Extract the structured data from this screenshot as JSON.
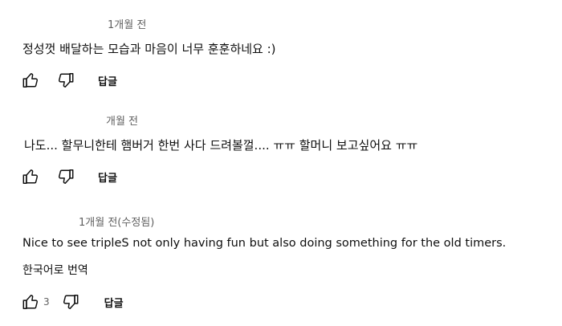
{
  "comments": [
    {
      "time": "1개월 전",
      "text": "정성껏 배달하는 모습과 마음이 너무 훈훈하네요 :)",
      "like_count": "",
      "reply_label": "답글"
    },
    {
      "time": "개월 전",
      "text": "나도... 할무니한테 햄버거 한번 사다 드려볼껄.... ㅠㅠ 할머니 보고싶어요 ㅠㅠ",
      "like_count": "",
      "reply_label": "답글"
    },
    {
      "time": "1개월 전(수정됨)",
      "text": "Nice to see tripleS not only having fun but also doing something for the old timers.",
      "translate_label": "한국어로 번역",
      "like_count": "3",
      "reply_label": "답글"
    }
  ],
  "icons": {
    "like": "thumbs-up-icon",
    "dislike": "thumbs-down-icon"
  }
}
